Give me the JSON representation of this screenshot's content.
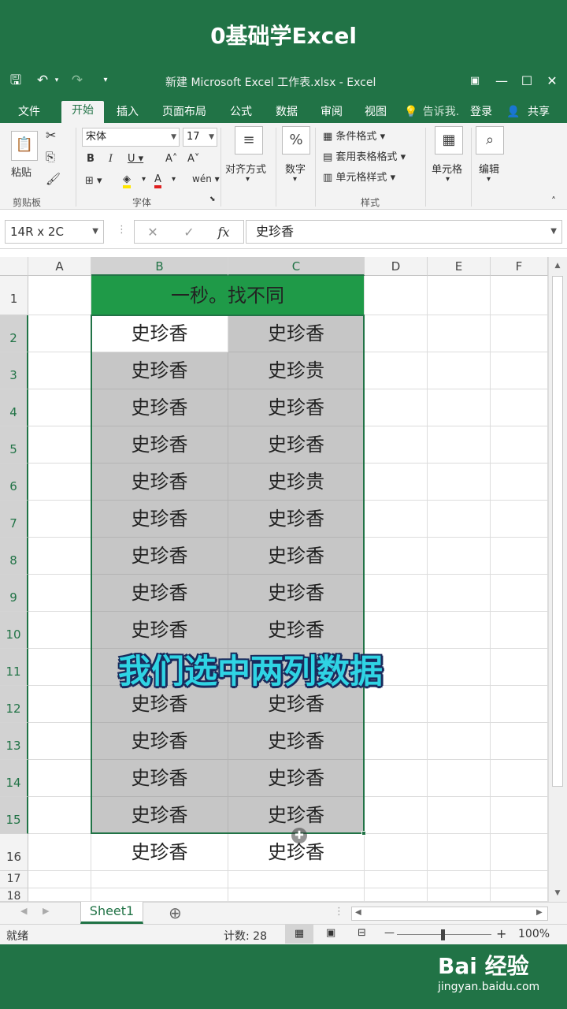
{
  "banner": {
    "title": "0基础学Excel"
  },
  "window": {
    "title": "新建 Microsoft Excel 工作表.xlsx - Excel",
    "save_icon": "save-icon",
    "undo_icon": "undo-icon",
    "redo_icon": "redo-icon"
  },
  "tabs": [
    "文件",
    "开始",
    "插入",
    "页面布局",
    "公式",
    "数据",
    "审阅",
    "视图"
  ],
  "active_tab": "开始",
  "tellme": "告诉我.",
  "login": "登录",
  "share": "共享",
  "ribbon": {
    "paste": "粘贴",
    "clipboard": "剪贴板",
    "font_name": "宋体",
    "font_size": "17",
    "font_group": "字体",
    "align": "对齐方式",
    "number": "数字",
    "cond_format": "条件格式",
    "table_format": "套用表格格式",
    "cell_style": "单元格样式",
    "styles_group": "样式",
    "cells": "单元格",
    "edit": "编辑"
  },
  "formula_bar": {
    "name_box": "14R x 2C",
    "value": "史珍香",
    "fx": "fx"
  },
  "columns": [
    "A",
    "B",
    "C",
    "D",
    "E",
    "F"
  ],
  "rows": [
    "1",
    "2",
    "3",
    "4",
    "5",
    "6",
    "7",
    "8",
    "9",
    "10",
    "11",
    "12",
    "13",
    "14",
    "15",
    "16",
    "17",
    "18"
  ],
  "header_cell": "一秒。找不同",
  "col_b": [
    "史珍香",
    "史珍香",
    "史珍香",
    "史珍香",
    "史珍香",
    "史珍香",
    "史珍香",
    "史珍香",
    "史珍香",
    "",
    "史珍香",
    "史珍香",
    "史珍香",
    "史珍香",
    "史珍香"
  ],
  "col_c": [
    "史珍香",
    "史珍贵",
    "史珍香",
    "史珍香",
    "史珍贵",
    "史珍香",
    "史珍香",
    "史珍香",
    "史珍香",
    "",
    "史珍香",
    "史珍香",
    "史珍香",
    "史珍香",
    "史珍香"
  ],
  "sheet": "Sheet1",
  "status": {
    "ready": "就绪",
    "count": "计数: 28",
    "zoom": "100%"
  },
  "caption": "我们选中两列数据",
  "watermark": {
    "logo": "Bai 经验",
    "url": "jingyan.baidu.com"
  }
}
